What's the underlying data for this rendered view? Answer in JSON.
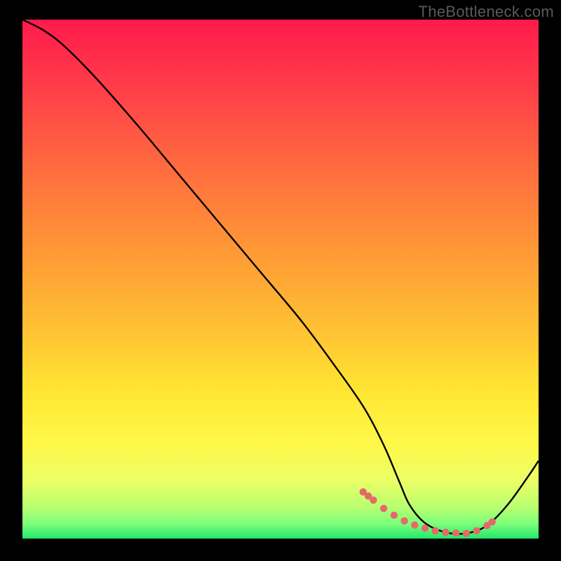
{
  "watermark": "TheBottleneck.com",
  "gradient": {
    "stops": [
      {
        "offset": "0%",
        "color": "#ff1a4b"
      },
      {
        "offset": "12%",
        "color": "#ff3a4a"
      },
      {
        "offset": "28%",
        "color": "#ff6a3f"
      },
      {
        "offset": "45%",
        "color": "#ff9a36"
      },
      {
        "offset": "60%",
        "color": "#ffc233"
      },
      {
        "offset": "72%",
        "color": "#ffe733"
      },
      {
        "offset": "82%",
        "color": "#fff84a"
      },
      {
        "offset": "89%",
        "color": "#eaff66"
      },
      {
        "offset": "94%",
        "color": "#b8ff70"
      },
      {
        "offset": "97%",
        "color": "#7fff7a"
      },
      {
        "offset": "100%",
        "color": "#23e86b"
      }
    ]
  },
  "curve_color": "#000000",
  "marker_color": "#e46a6a",
  "chart_data": {
    "type": "line",
    "title": "",
    "xlabel": "",
    "ylabel": "",
    "xlim": [
      0,
      100
    ],
    "ylim": [
      0,
      100
    ],
    "series": [
      {
        "name": "bottleneck-curve",
        "x": [
          0,
          4,
          8,
          14,
          22,
          30,
          38,
          46,
          54,
          60,
          66,
          70,
          73,
          75,
          78,
          82,
          86,
          90,
          94,
          98,
          100
        ],
        "y": [
          100,
          98,
          95,
          89,
          80,
          70.5,
          61,
          51.5,
          42,
          34,
          25.5,
          18,
          11,
          6.5,
          3,
          1.2,
          1,
          2.5,
          6.5,
          12,
          15
        ]
      }
    ],
    "markers": {
      "name": "highlighted-range",
      "x": [
        66,
        67,
        68,
        70,
        72,
        74,
        76,
        78,
        80,
        82,
        84,
        86,
        88,
        90,
        91
      ],
      "y": [
        9.0,
        8.2,
        7.4,
        5.8,
        4.5,
        3.4,
        2.6,
        2.0,
        1.5,
        1.2,
        1.05,
        1.0,
        1.5,
        2.5,
        3.2
      ]
    }
  }
}
